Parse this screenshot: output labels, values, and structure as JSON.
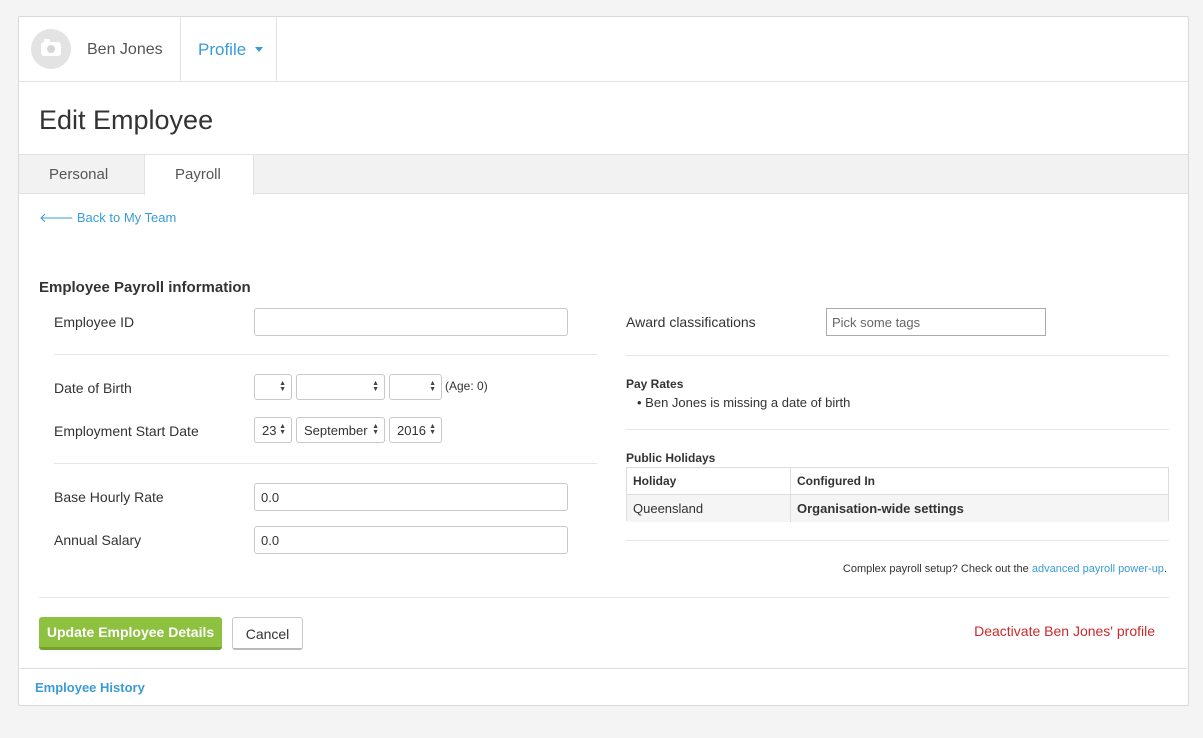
{
  "user": {
    "name": "Ben Jones"
  },
  "nav": {
    "profile_label": "Profile"
  },
  "page": {
    "title": "Edit Employee"
  },
  "tabs": [
    {
      "label": "Personal"
    },
    {
      "label": "Payroll"
    }
  ],
  "back_link": {
    "arrow": "🡐",
    "label": "Back to My Team"
  },
  "section_title": "Employee Payroll information",
  "form": {
    "employee_id": {
      "label": "Employee ID",
      "value": ""
    },
    "dob": {
      "label": "Date of Birth",
      "day": "",
      "month": "",
      "year": "",
      "age_text": "(Age: 0)"
    },
    "start_date": {
      "label": "Employment Start Date",
      "day": "23",
      "month": "September",
      "year": "2016"
    },
    "base_rate": {
      "label": "Base Hourly Rate",
      "value": "0.0"
    },
    "annual_salary": {
      "label": "Annual Salary",
      "value": "0.0"
    }
  },
  "right": {
    "award_label": "Award classifications",
    "tags_placeholder": "Pick some tags",
    "pay_rates_title": "Pay Rates",
    "pay_rates_items": [
      "Ben Jones is missing a date of birth"
    ],
    "public_holidays_title": "Public Holidays",
    "holiday_table": {
      "headers": [
        "Holiday",
        "Configured In"
      ],
      "rows": [
        [
          "Queensland",
          "Organisation-wide settings"
        ]
      ]
    },
    "complex_note": "Complex payroll setup? Check out the",
    "complex_link": "advanced payroll power-up",
    "complex_end": "."
  },
  "actions": {
    "update_label": "Update Employee Details",
    "cancel_label": "Cancel",
    "deactivate_label": "Deactivate Ben Jones' profile"
  },
  "history": {
    "label": "Employee History"
  },
  "colors": {
    "accent": "#3a9bd6",
    "success": "#8dc13f",
    "danger": "#cc2a2a"
  }
}
